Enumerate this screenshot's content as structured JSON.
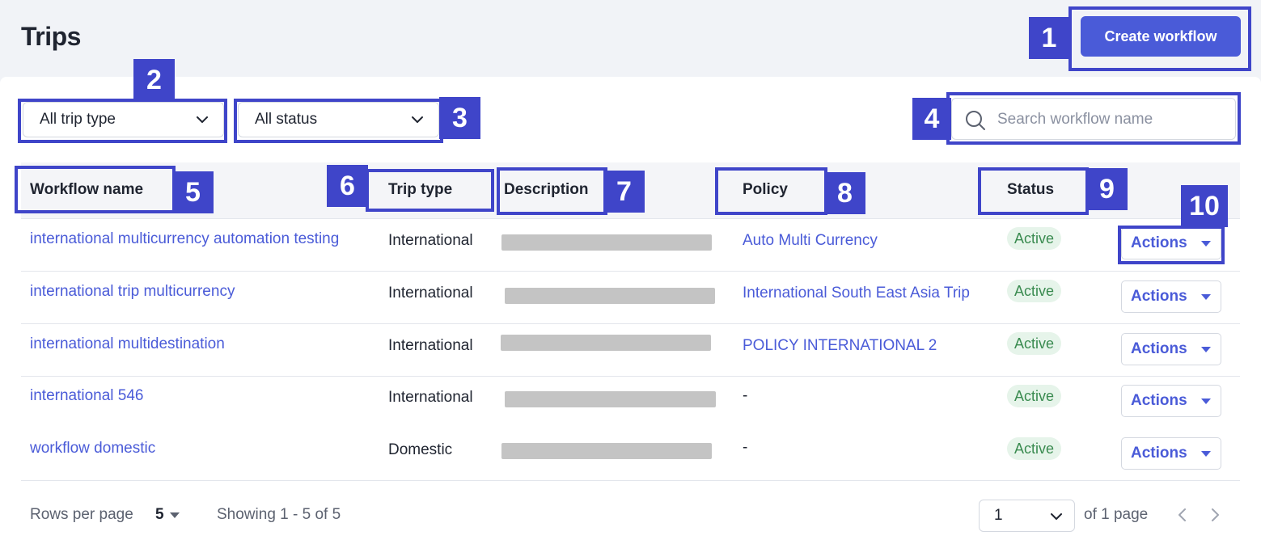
{
  "header": {
    "title": "Trips",
    "create_label": "Create workflow"
  },
  "filters": {
    "trip_type": "All trip type",
    "status": "All status",
    "search_placeholder": "Search workflow name"
  },
  "table": {
    "columns": [
      "Workflow name",
      "Trip type",
      "Description",
      "Policy",
      "Status"
    ],
    "rows": [
      {
        "name": "international multicurrency automation testing",
        "trip_type": "International",
        "description": "",
        "policy": "Auto Multi Currency",
        "status": "Active",
        "actions": "Actions"
      },
      {
        "name": "international trip multicurrency",
        "trip_type": "International",
        "description": "",
        "policy": "International South East Asia Trip",
        "status": "Active",
        "actions": "Actions"
      },
      {
        "name": "international multidestination",
        "trip_type": "International",
        "description": "",
        "policy": "POLICY INTERNATIONAL 2",
        "status": "Active",
        "actions": "Actions"
      },
      {
        "name": "international 546",
        "trip_type": "International",
        "description": "",
        "policy": "-",
        "status": "Active",
        "actions": "Actions"
      },
      {
        "name": "workflow domestic",
        "trip_type": "Domestic",
        "description": "",
        "policy": "-",
        "status": "Active",
        "actions": "Actions"
      }
    ]
  },
  "footer": {
    "rows_per_page_label": "Rows per page",
    "rows_per_page_value": "5",
    "showing": "Showing 1 - 5 of 5",
    "page_value": "1",
    "of_pages": "of 1 page"
  },
  "annotations": [
    "1",
    "2",
    "3",
    "4",
    "5",
    "6",
    "7",
    "8",
    "9",
    "10"
  ],
  "colors": {
    "accent": "#4a5bd8",
    "annotation": "#3f45c9",
    "active_badge_bg": "#e6f4ea",
    "active_badge_text": "#3a8b50"
  },
  "icons": {
    "search": "search-icon",
    "chevron": "chevron-down-icon",
    "caret": "caret-down-icon",
    "prev": "chevron-left-icon",
    "next": "chevron-right-icon"
  }
}
